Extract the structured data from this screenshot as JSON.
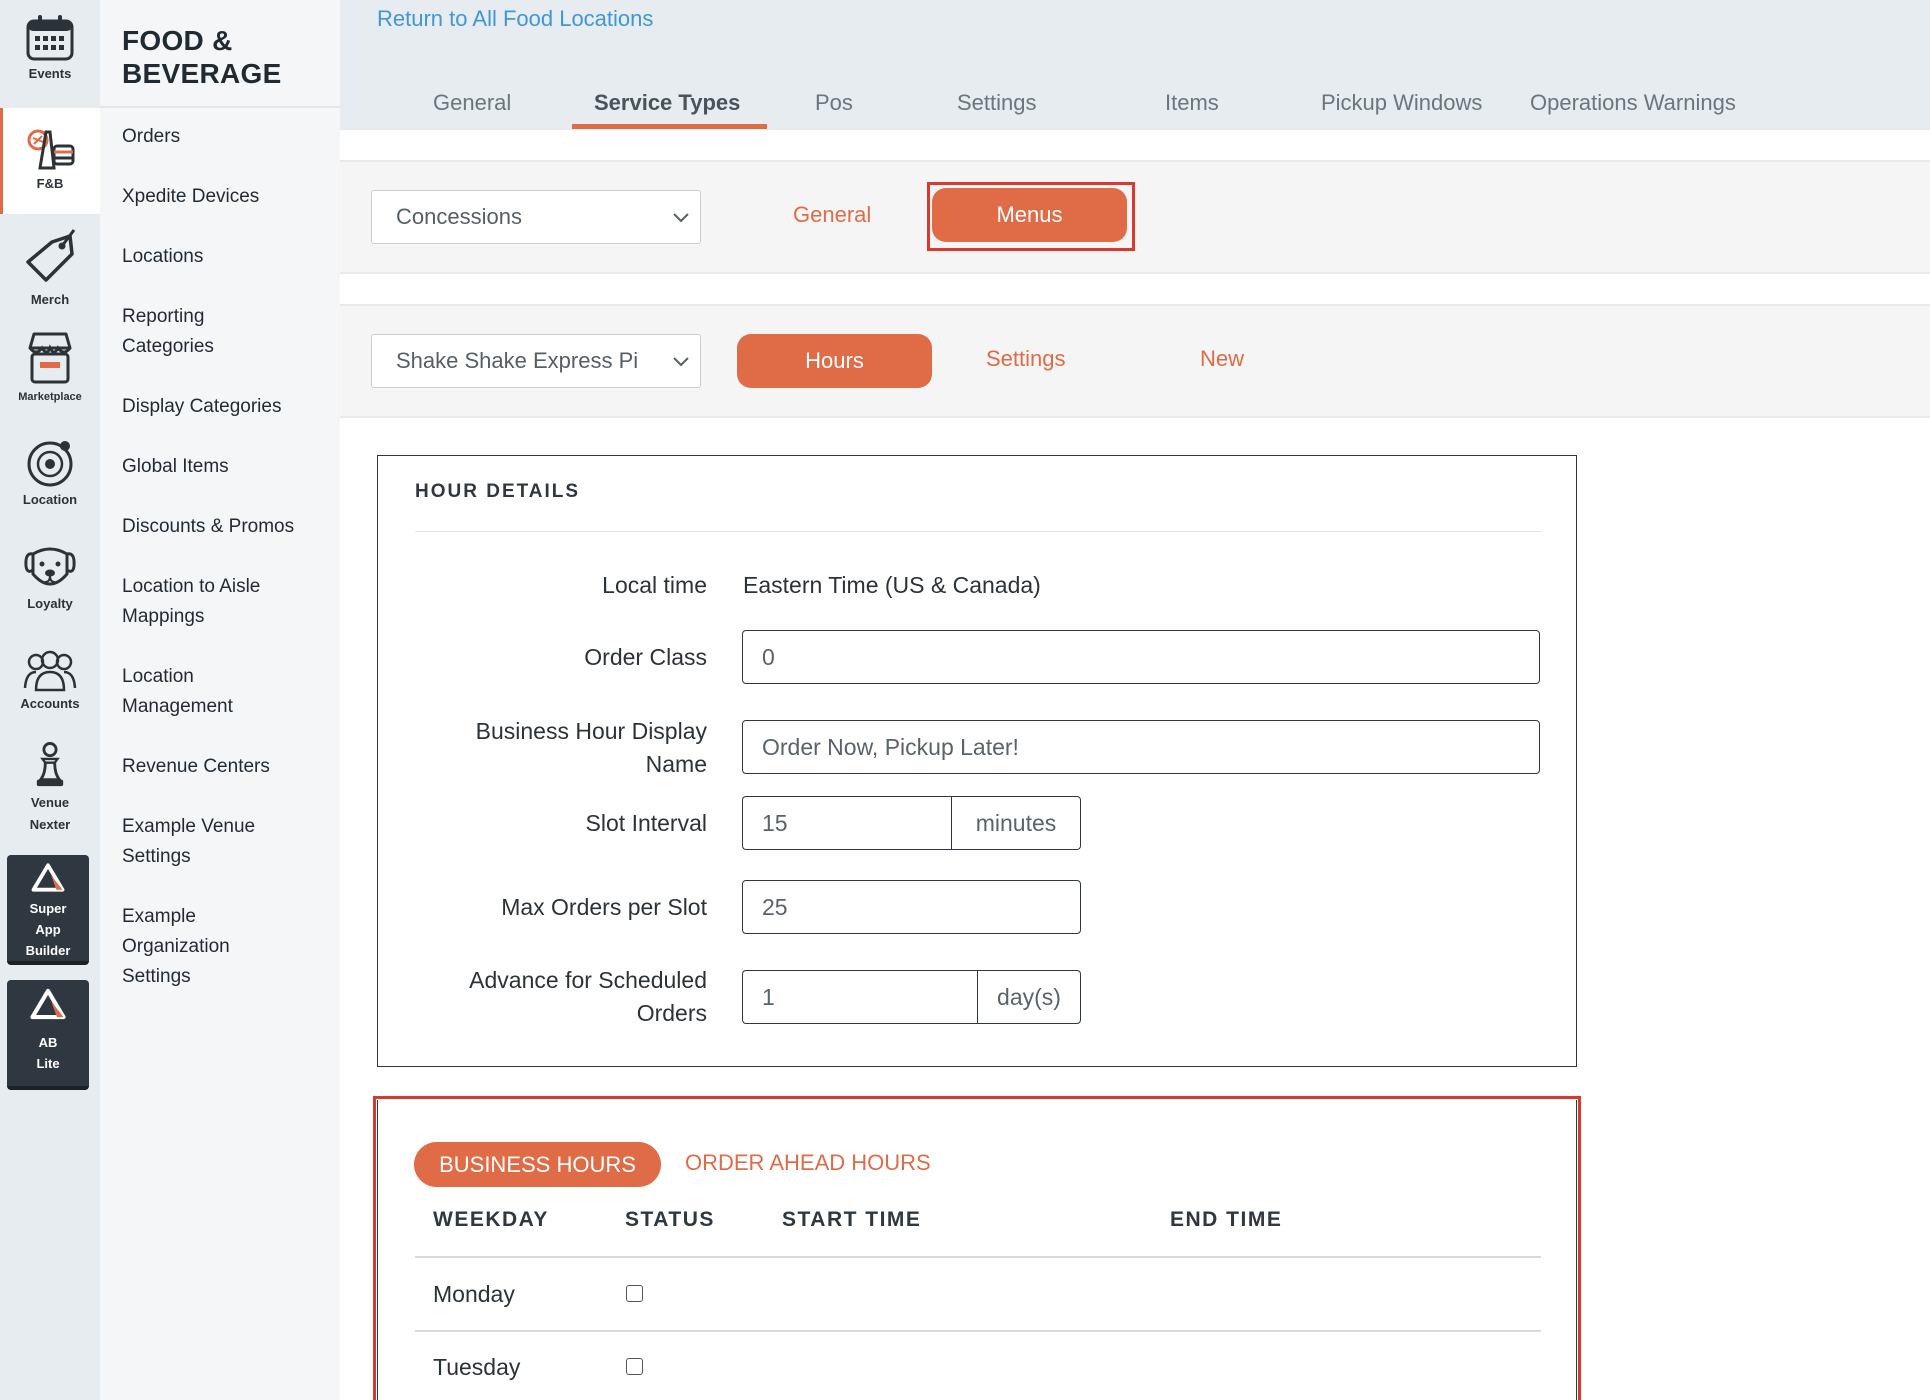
{
  "rail": {
    "events": "Events",
    "fnb": "F&B",
    "merch": "Merch",
    "marketplace": "Marketplace",
    "location": "Location",
    "loyalty": "Loyalty",
    "accounts": "Accounts",
    "venue_nexter_1": "Venue",
    "venue_nexter_2": "Nexter",
    "super_app_builder_1": "Super",
    "super_app_builder_2": "App",
    "super_app_builder_3": "Builder",
    "ab_lite_1": "AB",
    "ab_lite_2": "Lite"
  },
  "sidebar": {
    "title_line1": "FOOD &",
    "title_line2": "BEVERAGE",
    "links": [
      "Orders",
      "Xpedite Devices",
      "Locations",
      "Reporting Categories",
      "Display Categories",
      "Global Items",
      "Discounts & Promos",
      "Location to Aisle Mappings",
      "Location Management",
      "Revenue Centers",
      "Example Venue Settings",
      "Example Organization Settings"
    ]
  },
  "header": {
    "return_link": "Return to All Food Locations",
    "tabs": [
      "General",
      "Service Types",
      "Pos",
      "Settings",
      "Items",
      "Pickup Windows",
      "Operations Warnings"
    ]
  },
  "service_type_bar": {
    "select_value": "Concessions",
    "general_label": "General",
    "menus_label": "Menus"
  },
  "menu_bar": {
    "select_value": "Shake Shake Express Pi",
    "hours_label": "Hours",
    "settings_label": "Settings",
    "new_label": "New"
  },
  "hour_details": {
    "title": "HOUR DETAILS",
    "local_time_label": "Local time",
    "local_time_value": "Eastern Time (US & Canada)",
    "order_class_label": "Order Class",
    "order_class_value": "0",
    "display_name_label_1": "Business Hour Display",
    "display_name_label_2": "Name",
    "display_name_value": "Order Now, Pickup Later!",
    "slot_interval_label": "Slot Interval",
    "slot_interval_value": "15",
    "slot_interval_unit": "minutes",
    "max_orders_label": "Max Orders per Slot",
    "max_orders_value": "25",
    "advance_label_1": "Advance for Scheduled",
    "advance_label_2": "Orders",
    "advance_value": "1",
    "advance_unit": "day(s)"
  },
  "business_hours": {
    "business_tab": "BUSINESS HOURS",
    "order_ahead_tab": "ORDER AHEAD HOURS",
    "columns": [
      "WEEKDAY",
      "STATUS",
      "START TIME",
      "END TIME"
    ],
    "rows": [
      {
        "day": "Monday"
      },
      {
        "day": "Tuesday"
      }
    ]
  },
  "colors": {
    "accent": "#e06c47",
    "link": "#3f97d8",
    "highlight": "#d9392f"
  }
}
